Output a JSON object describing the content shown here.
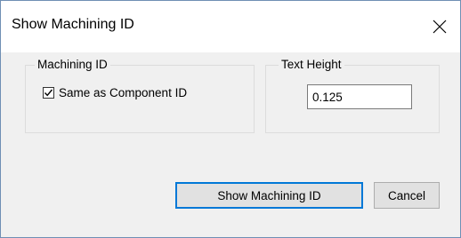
{
  "window": {
    "title": "Show Machining ID"
  },
  "machining_group": {
    "legend": "Machining ID",
    "checkbox_label": "Same as Component ID",
    "checked": true
  },
  "text_height_group": {
    "legend": "Text Height",
    "value": "0.125"
  },
  "buttons": {
    "show_label": "Show Machining ID",
    "cancel_label": "Cancel"
  },
  "colors": {
    "accent": "#0078d7",
    "window_border": "#6f8fb4",
    "background": "#f0f0f0"
  }
}
